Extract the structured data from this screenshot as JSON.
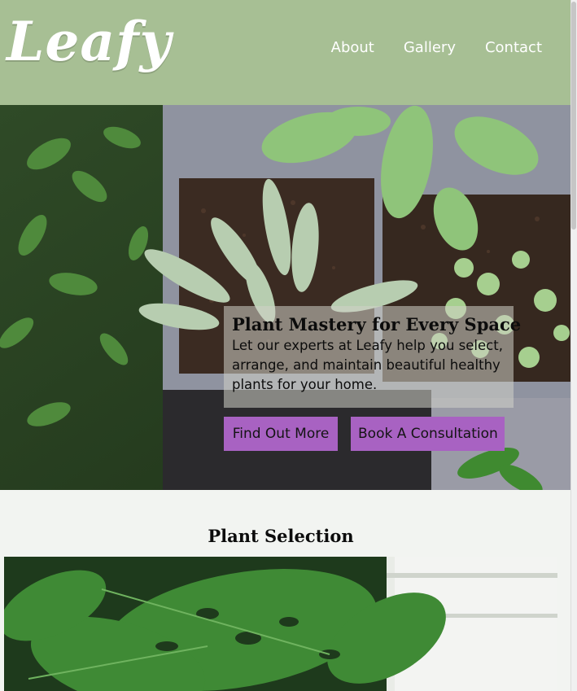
{
  "brand": {
    "logo": "Leafy"
  },
  "nav": {
    "items": [
      {
        "label": "About"
      },
      {
        "label": "Gallery"
      },
      {
        "label": "Contact"
      }
    ]
  },
  "hero": {
    "title": "Plant Mastery for Every Space",
    "text": "Let our experts at Leafy help you select, arrange, and maintain beautiful healthy plants for your home.",
    "buttons": {
      "primary": "Find Out More",
      "secondary": "Book A Consultation"
    }
  },
  "plant_selection": {
    "title": "Plant Selection"
  },
  "colors": {
    "header_bg": "#a7bf94",
    "button_bg": "#a862c2",
    "page_bg": "#f2f4f1"
  }
}
